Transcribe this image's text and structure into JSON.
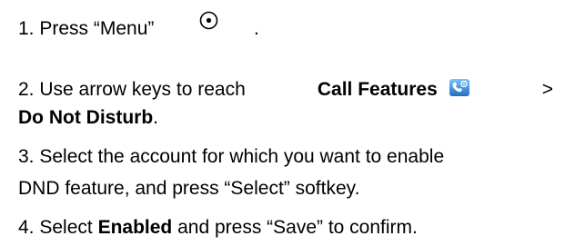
{
  "steps": {
    "s1": {
      "text": "1. Press “Menu”",
      "after": ".",
      "icon": "menu-circle-icon"
    },
    "s2": {
      "prefix": "2. Use arrow keys to reach",
      "bold1": "Call Features",
      "icon": "call-features-icon",
      "sep": ">",
      "bold2": "Do Not Disturb",
      "end": "."
    },
    "s3": {
      "line1": "3. Select the account for which you want to enable",
      "line2": "DND feature, and press “Select” softkey."
    },
    "s4": {
      "prefix": "4. Select",
      "bold": "Enabled",
      "suffix": "and press “Save” to confirm."
    }
  },
  "colors": {
    "text": "#000000",
    "icon_blue": "#2a7fd4"
  }
}
